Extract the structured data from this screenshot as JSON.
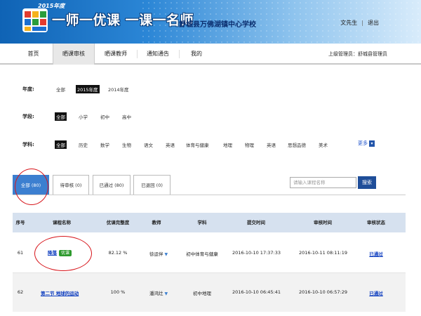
{
  "header": {
    "year_badge": "2015年度",
    "slogan": "一师一优课 一课一名师",
    "school": "舒城县万佛湖镇中心学校",
    "user": "文先生",
    "logout": "退出"
  },
  "nav": {
    "items": [
      "首页",
      "晒课审核",
      "晒课教师",
      "通知通告",
      "我的"
    ],
    "admin": "上级管理员：舒城县管理员"
  },
  "filters": {
    "year_label": "年度:",
    "year_options": [
      "全部",
      "2015年度",
      "2014年度"
    ],
    "section_label": "学段:",
    "section_options": [
      "全部",
      "小学",
      "初中",
      "高中"
    ],
    "subject_label": "学科:",
    "subject_options": [
      "全部",
      "历史",
      "数学",
      "生物",
      "语文",
      "英语",
      "体育与健康",
      "地理",
      "物理",
      "英语",
      "思想品德",
      "美术"
    ],
    "more": "更多"
  },
  "tabs": [
    "全部 (80)",
    "待审核 (0)",
    "已通过 (80)",
    "已退回 (0)"
  ],
  "search": {
    "placeholder": "请输入课程名称",
    "button": "搜索"
  },
  "table": {
    "headers": [
      "序号",
      "课程名称",
      "优课完整度",
      "教师",
      "学科",
      "提交时间",
      "审核时间",
      "审核状态"
    ],
    "rows": [
      {
        "no": "61",
        "course": "降落",
        "badge": "优课",
        "completeness": "82.12 %",
        "teacher": "徐运伴",
        "subject": "初中体育与健康",
        "submit": "2016-10-10 17:37:33",
        "review": "2016-10-11 08:11:19",
        "status": "已通过"
      },
      {
        "no": "62",
        "course": "第二节 地球的运动",
        "badge": "",
        "completeness": "100 %",
        "teacher": "潘鸿灶",
        "subject": "初中地理",
        "submit": "2016-10-10 06:45:41",
        "review": "2016-10-10 06:57:29",
        "status": "已通过"
      }
    ]
  },
  "colors": {
    "accent": "#3c7fd0",
    "link": "#0b3bbf",
    "annotation": "#d7141a"
  }
}
